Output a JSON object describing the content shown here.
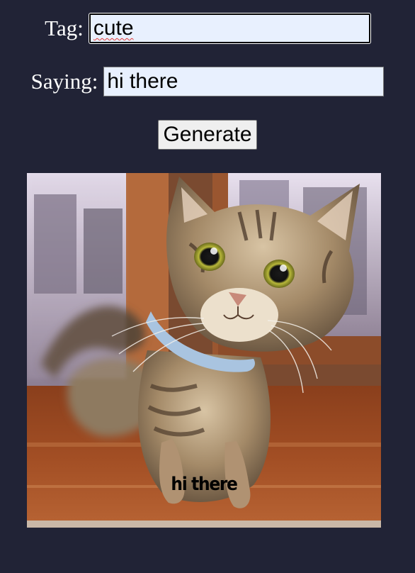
{
  "form": {
    "tag_label": "Tag:",
    "tag_value": "cute",
    "saying_label": "Saying:",
    "saying_value": "hi there",
    "generate_label": "Generate"
  },
  "image": {
    "subject": "tabby cat with light blue collar on wooden floor",
    "caption": "hi there"
  },
  "colors": {
    "page_background": "#212336",
    "input_background": "#e8f0fe",
    "button_background": "#efefef"
  }
}
